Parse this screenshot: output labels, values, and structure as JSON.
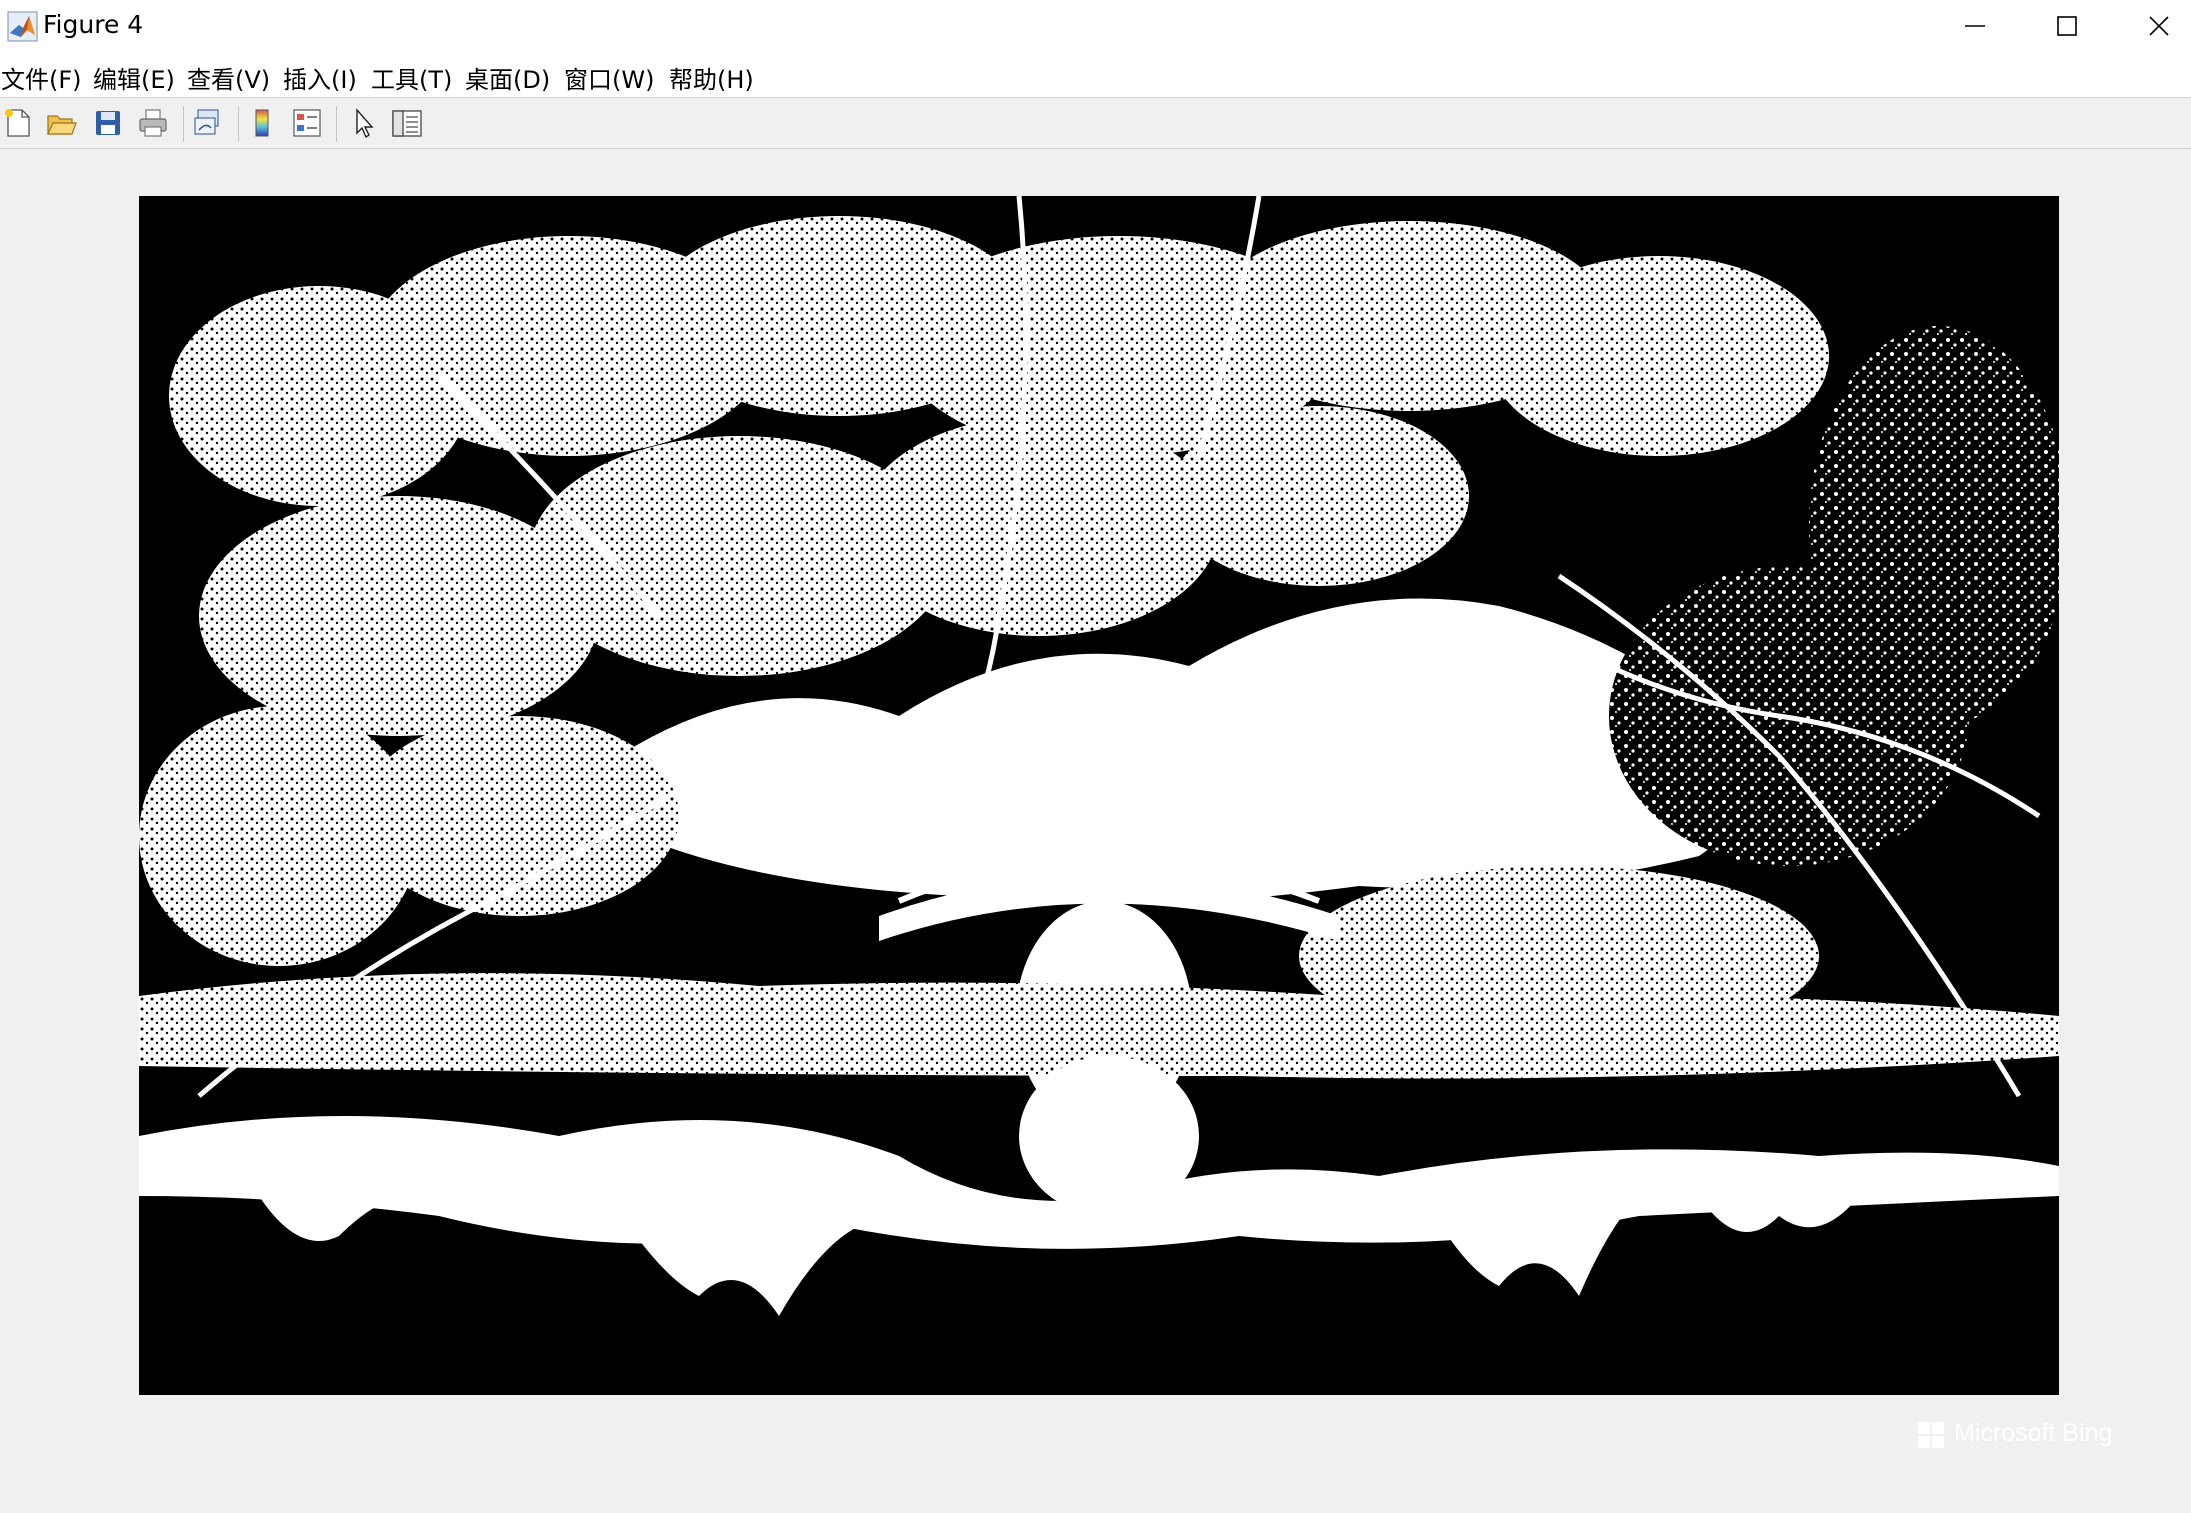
{
  "window": {
    "title": "Figure 4",
    "icon": "matlab-logo-icon",
    "controls": [
      "minimize-icon",
      "maximize-icon",
      "close-icon"
    ]
  },
  "menu": [
    {
      "label": "文件(F)"
    },
    {
      "label": "编辑(E)"
    },
    {
      "label": "查看(V)"
    },
    {
      "label": "插入(I)"
    },
    {
      "label": "工具(T)"
    },
    {
      "label": "桌面(D)"
    },
    {
      "label": "窗口(W)"
    },
    {
      "label": "帮助(H)"
    }
  ],
  "toolbar": {
    "tools": [
      "new-figure-icon",
      "open-file-icon",
      "save-icon",
      "print-icon",
      "link-plot-icon",
      "colorbar-icon",
      "legend-icon",
      "edit-plot-arrow-icon",
      "property-inspector-icon"
    ]
  },
  "figure": {
    "content": "binary black-and-white image of cherry blossom trees over an arched bridge reflected in water",
    "colors": {
      "foreground": "#ffffff",
      "background": "#000000"
    },
    "watermark": "Microsoft Bing"
  }
}
